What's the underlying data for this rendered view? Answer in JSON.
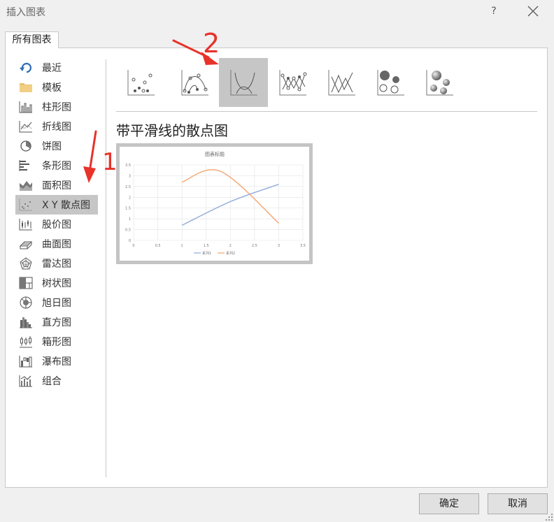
{
  "dialog": {
    "title": "插入图表",
    "help": "?",
    "tab_label": "所有图表",
    "ok_label": "确定",
    "cancel_label": "取消"
  },
  "sidebar": {
    "items": [
      {
        "label": "最近",
        "icon": "recent-icon"
      },
      {
        "label": "模板",
        "icon": "folder-icon"
      },
      {
        "label": "柱形图",
        "icon": "column-chart-icon"
      },
      {
        "label": "折线图",
        "icon": "line-chart-icon"
      },
      {
        "label": "饼图",
        "icon": "pie-chart-icon"
      },
      {
        "label": "条形图",
        "icon": "bar-chart-icon"
      },
      {
        "label": "面积图",
        "icon": "area-chart-icon"
      },
      {
        "label": "X Y 散点图",
        "icon": "scatter-chart-icon",
        "selected": true
      },
      {
        "label": "股价图",
        "icon": "stock-chart-icon"
      },
      {
        "label": "曲面图",
        "icon": "surface-chart-icon"
      },
      {
        "label": "雷达图",
        "icon": "radar-chart-icon"
      },
      {
        "label": "树状图",
        "icon": "treemap-chart-icon"
      },
      {
        "label": "旭日图",
        "icon": "sunburst-chart-icon"
      },
      {
        "label": "直方图",
        "icon": "histogram-chart-icon"
      },
      {
        "label": "箱形图",
        "icon": "box-whisker-chart-icon"
      },
      {
        "label": "瀑布图",
        "icon": "waterfall-chart-icon"
      },
      {
        "label": "组合",
        "icon": "combo-chart-icon"
      }
    ]
  },
  "subtypes": {
    "selected_index": 2,
    "selected_title": "带平滑线的散点图",
    "icons": [
      "scatter-icon",
      "scatter-smooth-markers-icon",
      "scatter-smooth-lines-icon",
      "scatter-straight-markers-icon",
      "scatter-straight-lines-icon",
      "bubble-icon",
      "bubble-3d-icon"
    ]
  },
  "annotations": {
    "arrow1_number": "1",
    "arrow2_number": "2",
    "color": "#e8322a"
  },
  "colors": {
    "selected_bg": "#c6c6c6",
    "series1": "#8faadc",
    "series2": "#f4a46f"
  },
  "chart_data": {
    "type": "scatter",
    "title": "图表标题",
    "xlim": [
      0,
      3.5
    ],
    "ylim": [
      0,
      3.5
    ],
    "x_ticks": [
      "0",
      "0.5",
      "1",
      "1.5",
      "2",
      "2.5",
      "3",
      "3.5"
    ],
    "y_ticks": [
      "0",
      "0.5",
      "1",
      "1.5",
      "2",
      "2.5",
      "3",
      "3.5"
    ],
    "grid": true,
    "legend": "bottom",
    "series": [
      {
        "name": "系列1",
        "color": "#8faadc",
        "x": [
          1,
          2,
          3
        ],
        "y": [
          0.7,
          1.8,
          2.6
        ]
      },
      {
        "name": "系列2",
        "color": "#f4a46f",
        "x": [
          1,
          1.8,
          3
        ],
        "y": [
          2.7,
          3.2,
          0.8
        ]
      }
    ]
  }
}
